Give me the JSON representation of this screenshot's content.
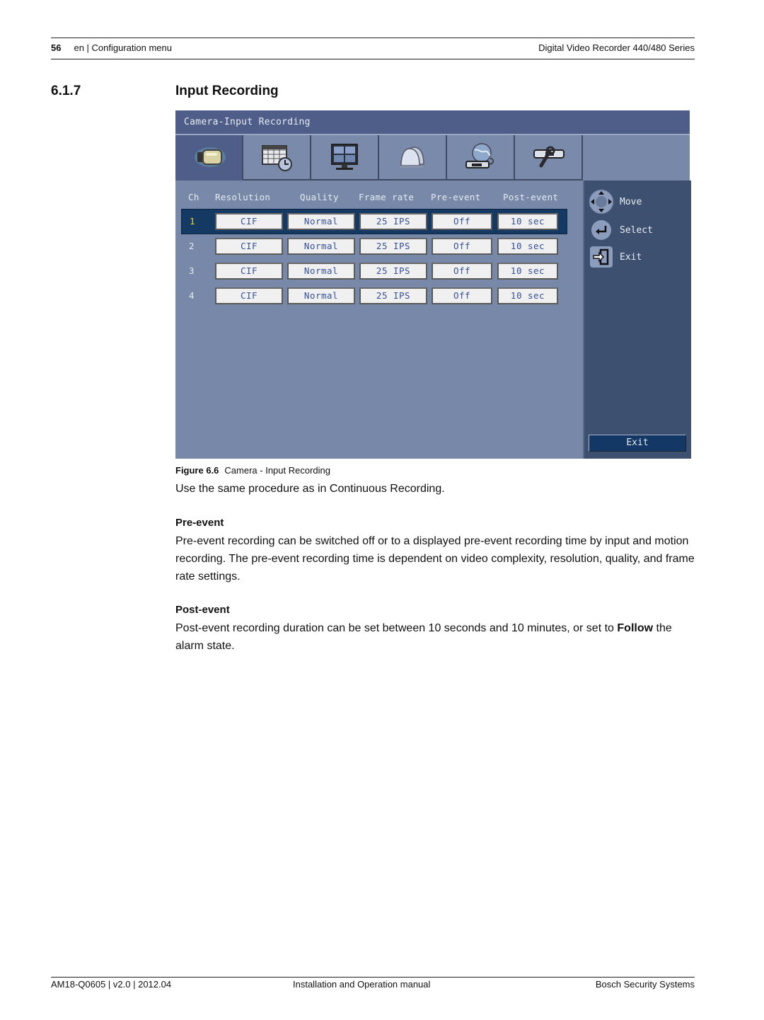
{
  "header": {
    "page_number": "56",
    "section_path": "en | Configuration menu",
    "product": "Digital Video Recorder 440/480 Series"
  },
  "section": {
    "number": "6.1.7",
    "title": "Input Recording"
  },
  "dvr": {
    "window_title": "Camera-Input  Recording",
    "tabs": [
      {
        "icon": "camera-icon",
        "active": true
      },
      {
        "icon": "schedule-calendar-clock-icon",
        "active": false
      },
      {
        "icon": "monitor-display-icon",
        "active": false
      },
      {
        "icon": "alarm-bell-icon",
        "active": false
      },
      {
        "icon": "network-globe-icon",
        "active": false
      },
      {
        "icon": "system-tools-wrench-icon",
        "active": false
      }
    ],
    "columns": [
      "Ch",
      "Resolution",
      "Quality",
      "Frame rate",
      "Pre-event",
      "Post-event"
    ],
    "rows": [
      {
        "ch": "1",
        "resolution": "CIF",
        "quality": "Normal",
        "frame_rate": "25 IPS",
        "pre_event": "Off",
        "post_event": "10 sec",
        "selected": true
      },
      {
        "ch": "2",
        "resolution": "CIF",
        "quality": "Normal",
        "frame_rate": "25 IPS",
        "pre_event": "Off",
        "post_event": "10 sec",
        "selected": false
      },
      {
        "ch": "3",
        "resolution": "CIF",
        "quality": "Normal",
        "frame_rate": "25 IPS",
        "pre_event": "Off",
        "post_event": "10 sec",
        "selected": false
      },
      {
        "ch": "4",
        "resolution": "CIF",
        "quality": "Normal",
        "frame_rate": "25 IPS",
        "pre_event": "Off",
        "post_event": "10 sec",
        "selected": false
      }
    ],
    "legend": [
      {
        "icon": "dpad-arrows-icon",
        "label": "Move"
      },
      {
        "icon": "enter-return-icon",
        "label": "Select"
      },
      {
        "icon": "exit-door-icon",
        "label": "Exit"
      }
    ],
    "exit_button": "Exit",
    "colors": {
      "title_bar": "#4f5e88",
      "panel_bg": "#7888a8",
      "side_panel": "#3e5070",
      "selected_row": "#143a64",
      "selected_channel_text": "#f2d820",
      "cell_text": "#36509a"
    }
  },
  "figure_caption": {
    "label": "Figure  6.6",
    "text": "Camera - Input Recording"
  },
  "body": {
    "intro": "Use the same procedure as in Continuous Recording.",
    "pre_event_heading": "Pre-event",
    "pre_event_text": "Pre-event recording can be switched off or to a displayed pre-event recording time by input and motion recording.  The pre-event recording time is dependent on video complexity, resolution, quality, and frame rate settings.",
    "post_event_heading": "Post-event",
    "post_event_text": "Post-event recording duration can be set between 10 seconds and 10 minutes, or set to",
    "post_event_bold": "Follow",
    "post_event_tail": " the alarm state."
  },
  "footer": {
    "doc_id": "AM18-Q0605 | v2.0 | 2012.04",
    "doc_type": "Installation and Operation manual",
    "company": "Bosch Security Systems"
  }
}
